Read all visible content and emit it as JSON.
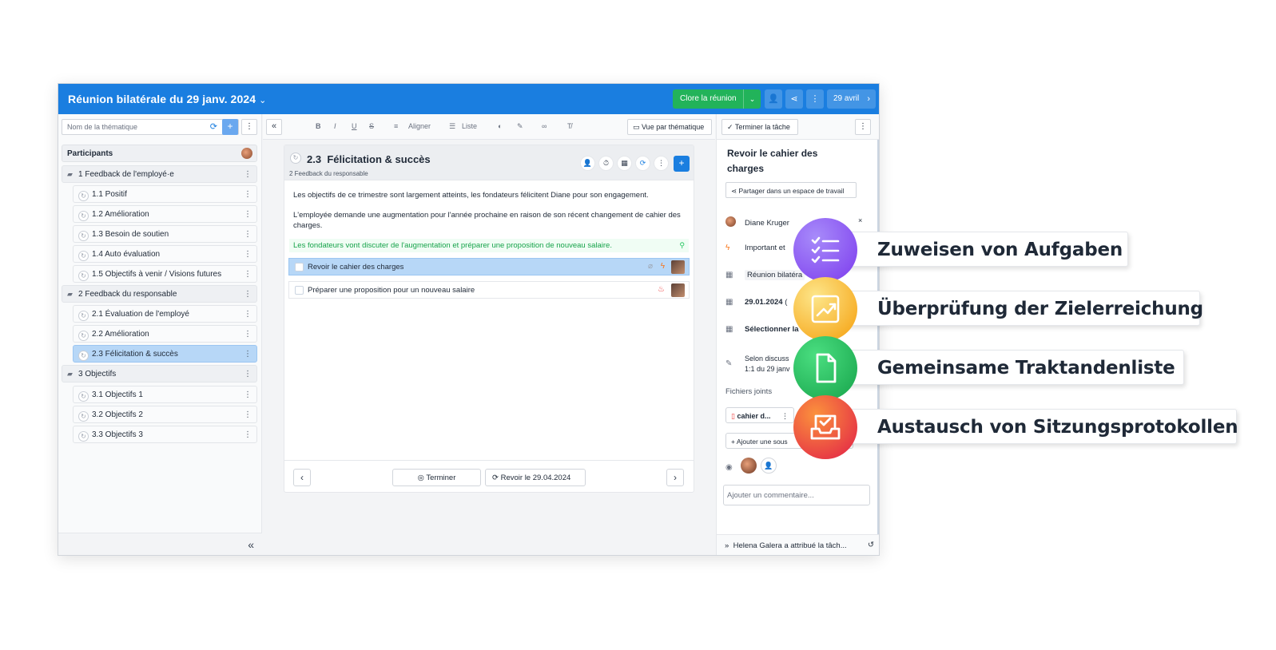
{
  "header": {
    "title": "Réunion bilatérale du 29 janv. 2024",
    "close_label": "Clore la réunion",
    "date_label": "29 avril"
  },
  "sidebar": {
    "search_placeholder": "Nom de la thématique",
    "participants_label": "Participants",
    "groups": [
      {
        "label": "1  Feedback de l'employé·e",
        "items": [
          "1.1  Positif",
          "1.2  Amélioration",
          "1.3  Besoin de soutien",
          "1.4  Auto évaluation",
          "1.5  Objectifs à venir / Visions futures"
        ]
      },
      {
        "label": "2  Feedback du responsable",
        "items": [
          "2.1  Évaluation de l'employé",
          "2.2  Amélioration",
          "2.3  Félicitation & succès"
        ]
      },
      {
        "label": "3  Objectifs",
        "items": [
          "3.1  Objectifs 1",
          "3.2  Objectifs 2",
          "3.3  Objectifs 3"
        ]
      }
    ]
  },
  "toolbar": {
    "align_label": "Aligner",
    "list_label": "Liste",
    "theme_view_label": "Vue par thématique"
  },
  "topic": {
    "number": "2.3",
    "title": "Félicitation & succès",
    "subtitle": "2 Feedback du responsable",
    "paragraphs": [
      "Les objectifs de ce trimestre sont largement atteints, les fondateurs félicitent Diane pour son engagement.",
      "L'employée demande une augmentation pour l'année prochaine en raison de son récent changement de cahier des charges."
    ],
    "decision": "Les fondateurs vont discuter de l'augmentation et préparer une proposition de nouveau salaire.",
    "tasks": [
      "Revoir le cahier des charges",
      "Préparer une proposition pour un nouveau salaire"
    ],
    "finish_label": "Terminer",
    "review_label": "Revoir le 29.04.2024"
  },
  "task_panel": {
    "finish_task_label": "Terminer la tâche",
    "title": "Revoir le cahier des charges",
    "share_label": "Partager dans un espace de travail",
    "assignee": "Diane Kruger",
    "priority": "Important et",
    "meeting": "Réunion bilatéra",
    "due_date": "29.01.2024",
    "due_suffix": "(",
    "select_label": "Sélectionner la",
    "note_line1": "Selon discuss",
    "note_line2": "1:1 du 29 janv",
    "attachments_label": "Fichiers joints",
    "file_name": "cahier d...",
    "add_subtask_label": "Ajouter une sous",
    "comment_placeholder": "Ajouter un commentaire...",
    "activity": "Helena Galera a attribué la tâch..."
  },
  "features": [
    {
      "label": "Zuweisen von Aufgaben",
      "icon": "task-list-icon",
      "color": "#8b5cf6"
    },
    {
      "label": "Überprüfung der Zielerreichung",
      "icon": "growth-chart-icon",
      "color": "#fbbf24"
    },
    {
      "label": "Gemeinsame Traktandenliste",
      "icon": "document-icon",
      "color": "#22c55e"
    },
    {
      "label": "Austausch von Sitzungsprotokollen",
      "icon": "inbox-check-icon",
      "color": "#f43f5e"
    }
  ],
  "colors": {
    "brand_blue": "#1a7ee0",
    "close_green": "#22b35a",
    "selection_blue": "#b7d7f7",
    "decision_green": "#16a34a"
  }
}
